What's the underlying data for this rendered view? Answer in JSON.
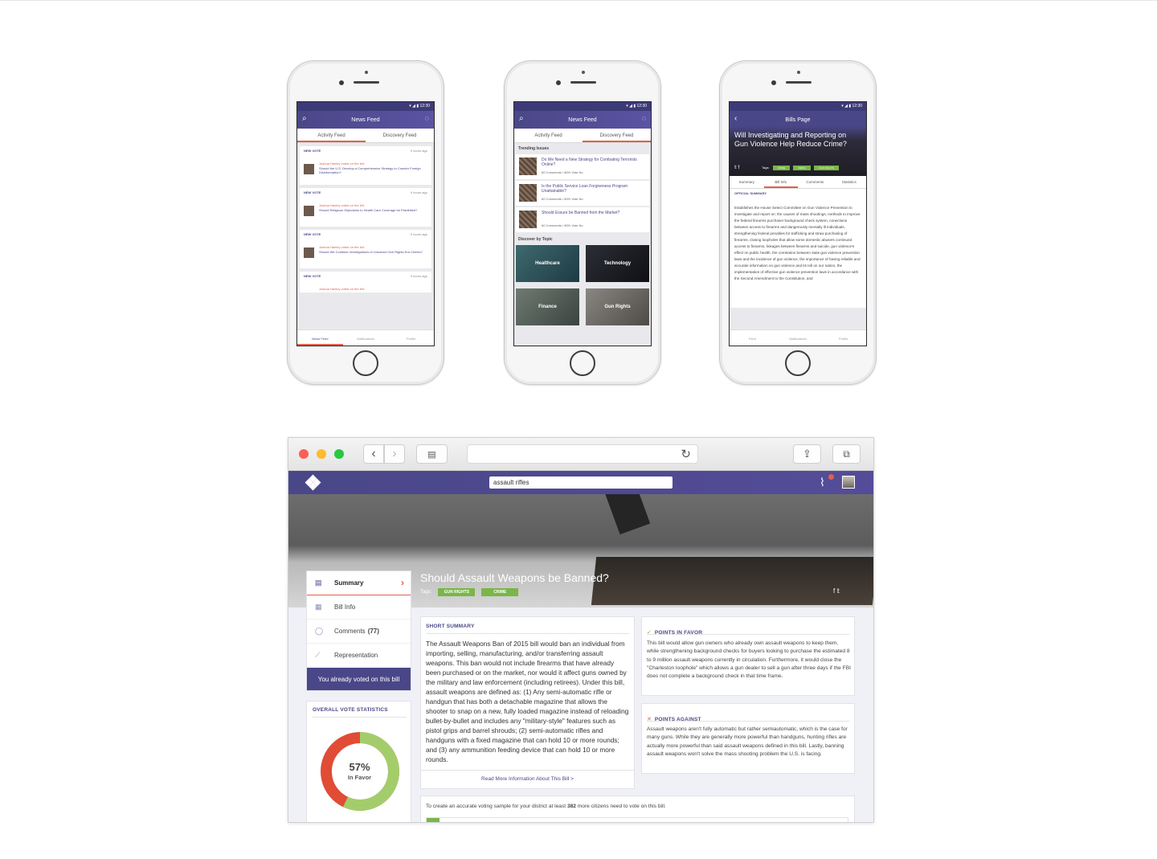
{
  "phone1": {
    "status": "▾ ◢ ▮ 12:30",
    "title": "News Feed",
    "tabs": [
      "Activity Feed",
      "Discovery Feed"
    ],
    "items": [
      {
        "label": "NEW VOTE",
        "time": "9 hours ago",
        "user": "Joshua Hanley voted on the bill:",
        "bill": "Should the U.S. Develop a Comprehensive Strategy to Counter Foreign Disinformation?"
      },
      {
        "label": "NEW VOTE",
        "time": "9 hours ago",
        "user": "Joshua Hanley voted on the bill:",
        "bill": "Should Religious Objections to Health Care Coverage be Prohibited?"
      },
      {
        "label": "NEW VOTE",
        "time": "9 hours ago",
        "user": "Joshua Hanley voted on the bill:",
        "bill": "Should We Continue Investigations of Unsolved Civil Rights Era Crimes?"
      },
      {
        "label": "NEW VOTE",
        "time": "9 hours ago",
        "user": "Joshua Hanley voted on the bill:",
        "bill": ""
      }
    ],
    "tabbar": [
      "News Feed",
      "Notifications",
      "Profile"
    ]
  },
  "phone2": {
    "status": "▾ ◢ ▮ 12:30",
    "title": "News Feed",
    "tabs": [
      "Activity Feed",
      "Discovery Feed"
    ],
    "trending_label": "Trending Issues",
    "issues": [
      {
        "title": "Do We Need a New Strategy for Combating Terrorists Online?",
        "meta": "60 Comments / 80% Vote No"
      },
      {
        "title": "Is the Public Service Loan Forgiveness Program Unattainable?",
        "meta": "60 Comments / 80% Vote No"
      },
      {
        "title": "Should Essure be Banned from the Market?",
        "meta": "60 Comments / 80% Vote No"
      }
    ],
    "discover_label": "Discover by Topic",
    "topics": [
      "Healthcare",
      "Technology",
      "Finance",
      "Gun Rights"
    ]
  },
  "phone3": {
    "status": "▾ ◢ ▮ 12:30",
    "title": "Bills Page",
    "question": "Will Investigating and Reporting on Gun Violence Help Reduce Crime?",
    "tags_label": "Tags:",
    "tags": [
      "CRIME",
      "MEDIA",
      "GUN RIGHTS"
    ],
    "tabs": [
      "Summary",
      "Bill Info",
      "Comments",
      "Statistics"
    ],
    "section": "OFFICIAL SUMMARY",
    "body": "Establishes the House Select Committee on Gun Violence Prevention to investigate and report on: the causes of mass shootings, methods to improve the federal firearms purchaser background check system, conections between access to firearms and dangerously mentally ill individuals, strengthening federal penalties for trafficking and straw purchasing of firearms, closing loopholes that allow some domestic abusers continued access to firearms, linkages between firearms and suicide, gun violence's effect on public health, the correlation between state gun violence prevention laws and the incidence of gun violence, the importance of having reliable and accurate information on gun violence and its toll on our nation, the implementation of effective gun violence prevention laws in accordance with the Second Amendment to the Constitution, and",
    "tabbar": [
      "Feed",
      "Notifications",
      "Profile"
    ]
  },
  "browser": {
    "search_value": "assault rifles",
    "headline": "Should Assault Weapons be Banned?",
    "tags_label": "Tags:",
    "tags": [
      "GUN RIGHTS",
      "CRIME"
    ],
    "social": "f ✓",
    "nav": [
      {
        "label": "Summary",
        "icon": "document-icon"
      },
      {
        "label": "Bill Info",
        "icon": "info-icon"
      },
      {
        "label": "Comments",
        "count": "(77)",
        "icon": "comment-icon"
      },
      {
        "label": "Representation",
        "icon": "chart-icon"
      }
    ],
    "voted": "You already voted on this bill",
    "stats_title": "OVERALL VOTE STATISTICS",
    "stats_percent": "57%",
    "stats_caption": "In Favor",
    "favor_fraction": 0.57,
    "short_summary_title": "SHORT SUMMARY",
    "short_summary": "The Assault Weapons Ban of 2015 bill would ban an individual from importing, selling, manufacturing, and/or transferring assault weapons. This ban would not include firearms that have already been purchased or on the market, nor would it affect guns owned by the military and law enforcement (including retirees). Under this bill, assault weapons are defined as: (1) Any semi-automatic rifle or handgun that has both a detachable magazine that allows the shooter to snap on a new, fully loaded magazine instead of reloading bullet-by-bullet and includes any \"military-style\" features such as pistol grips and barrel shrouds; (2) semi-automatic rifles and handguns with a fixed magazine that can hold 10 or more rounds; and (3) any ammunition feeding device that can hold 10 or more rounds.",
    "read_more": "Read More Information About This Bill >",
    "favor_title": "POINTS IN FAVOR",
    "favor_text": "This bill would allow gun owners who already own assault weapons to keep them, while strengthening background checks for buyers looking to purchase the estimated 8 to 9 million assault weapons currently in circulation. Furthermore, it would close the \"Charleston loophole\" which allows a gun dealer to sell a gun after three days if the FBI does not complete a background check in that time frame.",
    "against_title": "POINTS AGAINST",
    "against_text": "Assault weapons aren't fully automatic but rather semiautomatic, which is the case for many guns. While they are generally more powerful than handguns, hunting rifles are actually more powerful than said assault weapons defined in this bill. Lastly, banning assault weapons won't solve the mass shooting problem the U.S. is facing.",
    "sample_pre": "To create an accurate voting sample for your district at least",
    "sample_count": "382",
    "sample_post": "more citizens need to vote on this bill.",
    "sample_progress": 0.03,
    "colors": {
      "brand": "#4a4788",
      "accent": "#e2604a",
      "favor": "#a3cd6b",
      "against": "#e04c36"
    }
  }
}
